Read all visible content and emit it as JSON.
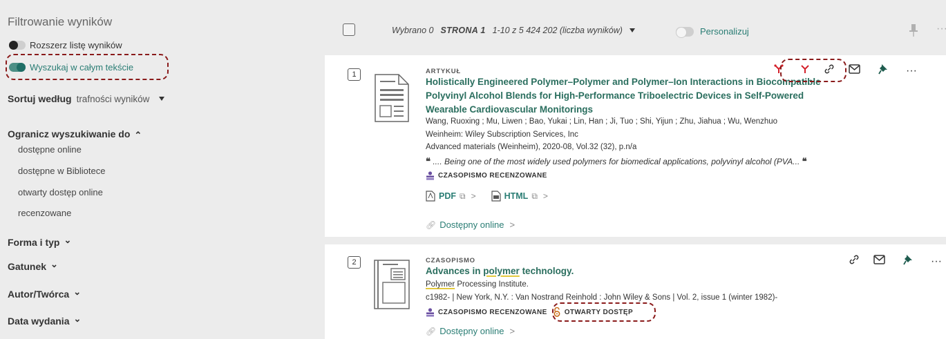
{
  "sidebar": {
    "title": "Filtrowanie wyników",
    "toggle_expand": "Rozszerz listę wyników",
    "toggle_fulltext": "Wyszukaj w całym tekście",
    "sort_label": "Sortuj według",
    "sort_value": "trafności wyników",
    "limit_heading": "Ogranicz wyszukiwanie do",
    "limit_items": [
      "dostępne online",
      "dostępne w Bibliotece",
      "otwarty dostęp online",
      "recenzowane"
    ],
    "sections": [
      "Forma i typ",
      "Gatunek",
      "Autor/Twórca",
      "Data wydania"
    ]
  },
  "topbar": {
    "selected": "Wybrano 0",
    "page": "STRONA 1",
    "range": "1-10 z 5 424 202 (liczba wyników)",
    "personalize": "Personalizuj"
  },
  "results": [
    {
      "number": "1",
      "type": "ARTYKUŁ",
      "title_lines": [
        "Holistically Engineered Polymer–Polymer and Polymer–Ion Interactions in Biocompatible",
        "Polyvinyl Alcohol Blends for High-Performance Triboelectric Devices in Self-Powered",
        "Wearable Cardiovascular Monitorings"
      ],
      "authors": "Wang, Ruoxing ; Mu, Liwen ; Bao, Yukai ; Lin, Han ; Ji, Tuo ; Shi, Yijun ; Zhu, Jiahua ; Wu, Wenzhuo",
      "publisher": "Weinheim: Wiley Subscription Services, Inc",
      "source": "Advanced materials (Weinheim), 2020-08, Vol.32 (32), p.n/a",
      "snippet": ".... Being one of the most widely used polymers for biomedical applications, polyvinyl alcohol (PVA...",
      "badge": "CZASOPISMO RECENZOWANE",
      "pdf_label": "PDF",
      "html_label": "HTML",
      "online": "Dostępny online"
    },
    {
      "number": "2",
      "type": "CZASOPISMO",
      "title_pre": "Advances in ",
      "title_hl": "polymer",
      "title_post": " technology.",
      "publisher_hl": "Polymer",
      "publisher_rest": " Processing Institute.",
      "details": "c1982- | New York, N.Y. : Van Nostrand Reinhold : John Wiley & Sons | Vol. 2, issue 1 (winter 1982)-",
      "badge": "CZASOPISMO RECENZOWANE",
      "oa_badge": "OTWARTY DOSTĘP",
      "online": "Dostępny online"
    }
  ],
  "icons": {
    "snippet_quote": "❝",
    "more": "···",
    "chevron_up": "⌃",
    "chevron_down": "⌄"
  },
  "colors": {
    "accent": "#2a7d74",
    "title": "#2a6e5e",
    "annotation": "#8a1a1a",
    "citation_icon": "#d4202a",
    "open_access": "#c96a16",
    "badge_icon": "#6a4fa0"
  }
}
